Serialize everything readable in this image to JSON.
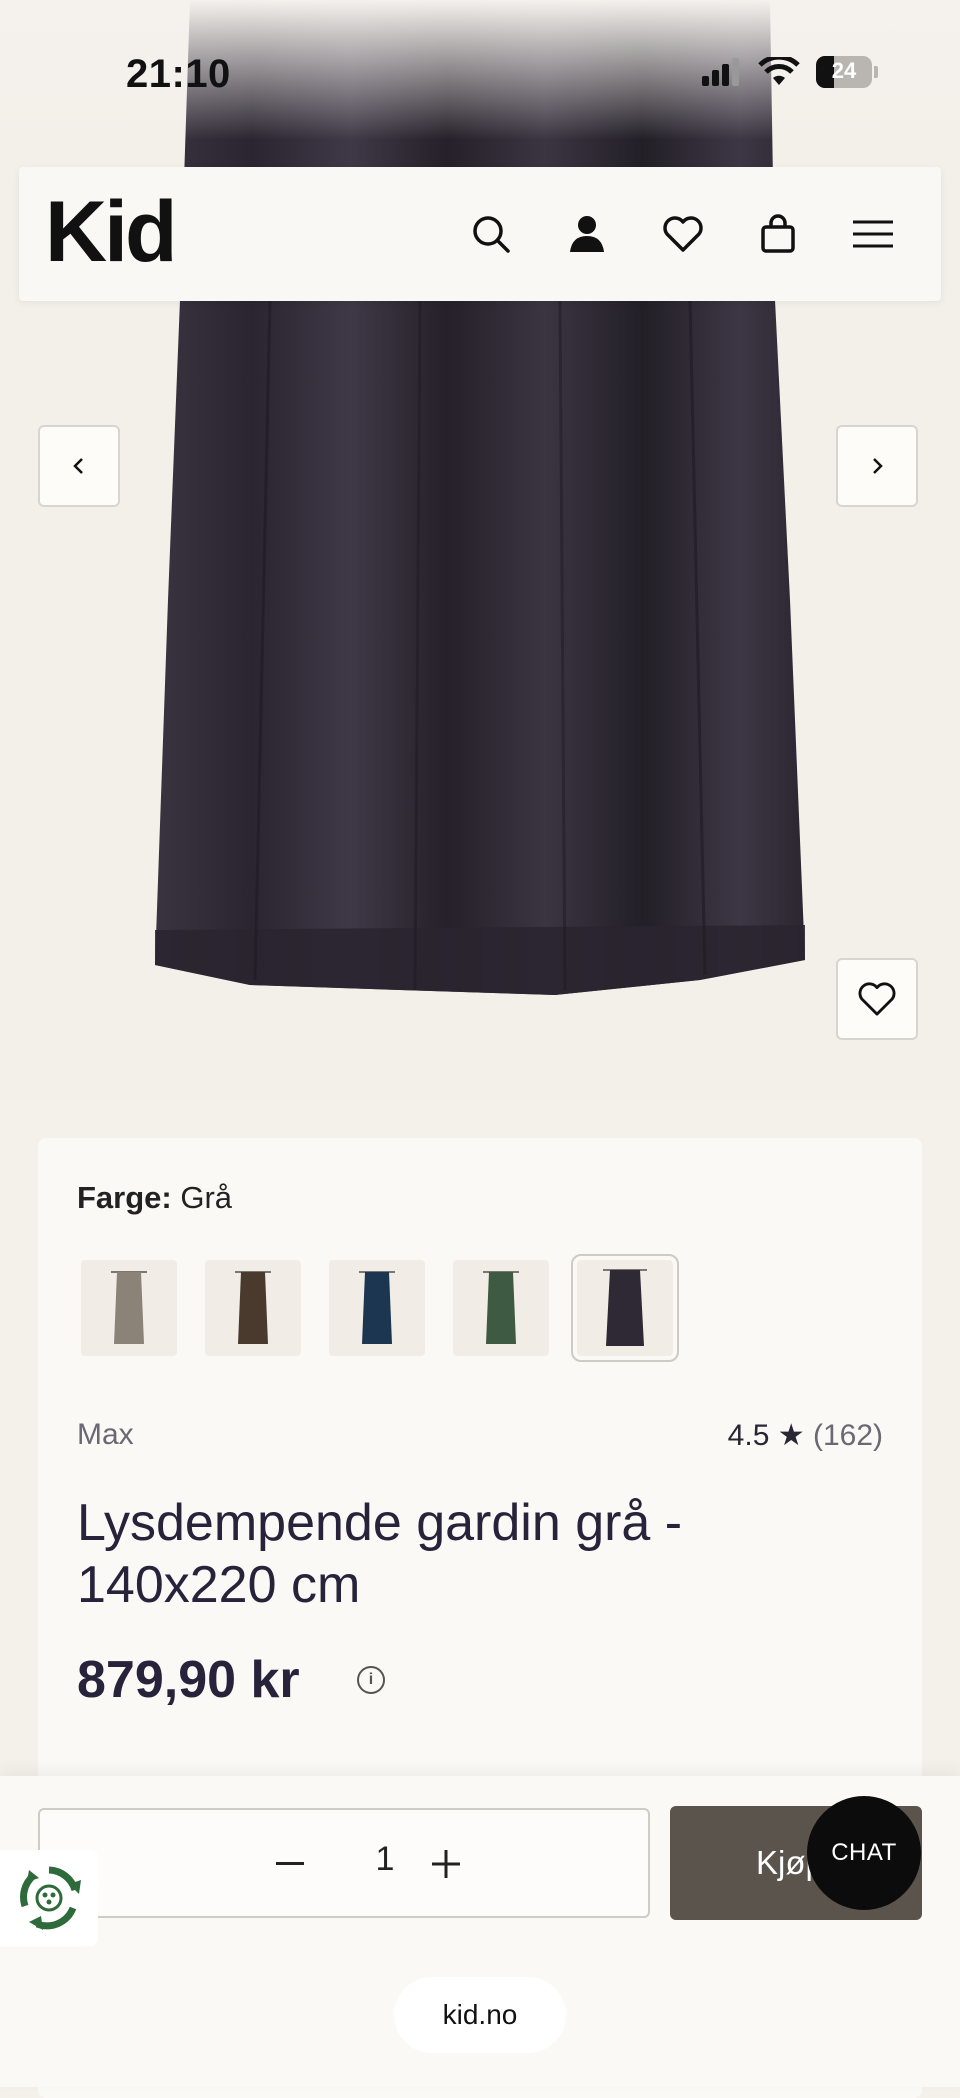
{
  "status_bar": {
    "time": "21:10",
    "battery": "24"
  },
  "header": {
    "logo": "Kid",
    "icons": [
      "search-icon",
      "account-icon",
      "wishlist-icon",
      "cart-icon",
      "menu-icon"
    ]
  },
  "gallery": {
    "prev_icon": "chevron-left-icon",
    "next_icon": "chevron-right-icon",
    "favorite_icon": "heart-icon"
  },
  "product": {
    "color_label": "Farge:",
    "color_value": "Grå",
    "swatches": [
      {
        "name": "beige",
        "color": "#8b8278"
      },
      {
        "name": "brown",
        "color": "#4a3a2e"
      },
      {
        "name": "blue",
        "color": "#1c3550"
      },
      {
        "name": "green",
        "color": "#3e5a42"
      },
      {
        "name": "grey",
        "color": "#2e2934",
        "selected": true
      }
    ],
    "brand": "Max",
    "rating": "4.5 ★",
    "rating_count": "(162)",
    "title": "Lysdempende gardin grå - 140x220 cm",
    "price": "879,90 kr",
    "price_info": "i"
  },
  "cart": {
    "quantity": "1",
    "buy_label": "Kjøp"
  },
  "chat": {
    "label": "CHAT"
  },
  "browser": {
    "url": "kid.no"
  }
}
